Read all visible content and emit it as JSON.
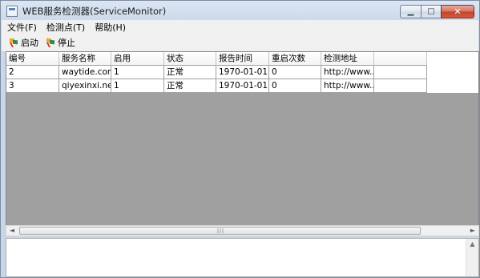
{
  "window": {
    "title": "WEB服务检测器(ServiceMonitor)",
    "controls": {
      "minimize": "▁",
      "maximize": "□",
      "close": "✕"
    }
  },
  "menu": [
    "文件(F)",
    "检测点(T)",
    "帮助(H)"
  ],
  "toolbar": {
    "start_label": "启动",
    "stop_label": "停止",
    "icon": "flag-icon"
  },
  "table": {
    "columns": [
      "编号",
      "服务名称",
      "启用",
      "状态",
      "报告时间",
      "重启次数",
      "检测地址"
    ],
    "rows": [
      [
        "2",
        "waytide.com",
        "1",
        "正常",
        "1970-01-01 ...",
        "0",
        "http://www...."
      ],
      [
        "3",
        "qiyexinxi.net",
        "1",
        "正常",
        "1970-01-01 ...",
        "0",
        "http://www...."
      ]
    ]
  },
  "scrollbar": {
    "grip": "|||",
    "left_arrow": "◄",
    "right_arrow": "►",
    "up_arrow": "▲"
  },
  "colors": {
    "grid_empty": "#a0a0a0",
    "title_gradient": "#dbe6f3",
    "close_button": "#c0452c"
  }
}
